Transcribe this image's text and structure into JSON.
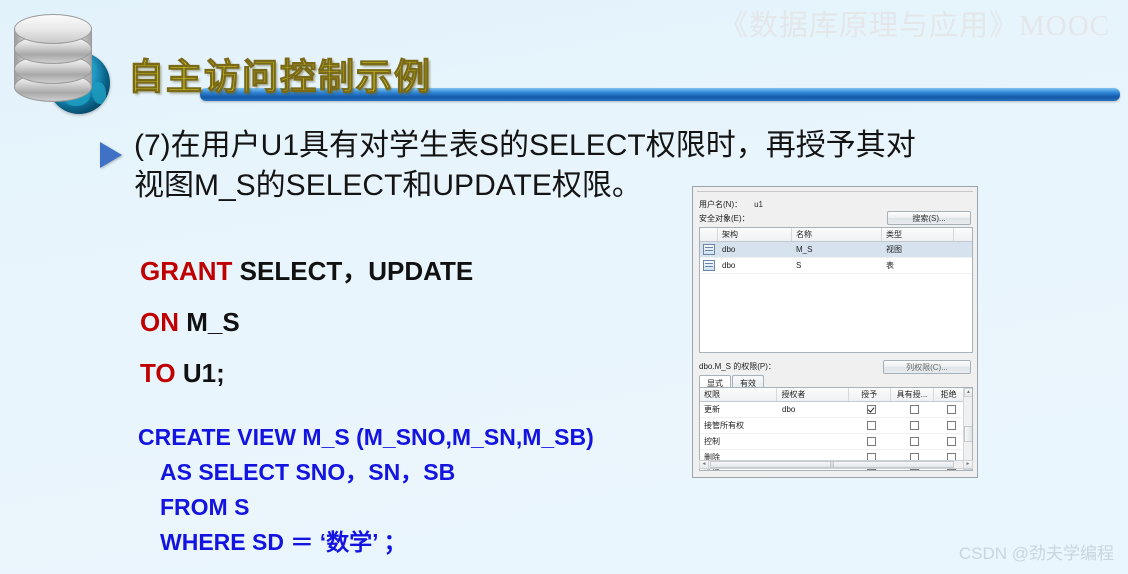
{
  "watermarks": {
    "top_right_cn": "《数据库原理与应用》",
    "top_right_en": "MOOC",
    "bottom_right": "CSDN @劲夫学编程"
  },
  "slide": {
    "title": "自主访问控制示例",
    "body_lines": [
      "(7)在用户U1具有对学生表S的SELECT权限时，再授予其对",
      "视图M_S的SELECT和UPDATE权限。"
    ]
  },
  "sql_grant": {
    "line1_kw": "GRANT",
    "line1_rest": " SELECT，UPDATE",
    "line2_kw": "ON",
    "line2_rest": " M_S",
    "line3_kw": "TO",
    "line3_rest": " U1;"
  },
  "sql_view": {
    "lines": [
      "CREATE VIEW M_S  (M_SNO,M_SN,M_SB)",
      "AS SELECT SNO，SN，SB",
      "FROM S",
      "WHERE SD ＝ ‘数学’ ；"
    ]
  },
  "dialog": {
    "user_label": "用户名(N)：",
    "user_value": "u1",
    "securable_label": "安全对象(E)：",
    "search_button": "搜索(S)...",
    "objects_headers": [
      "架构",
      "名称",
      "类型"
    ],
    "objects_rows": [
      {
        "schema": "dbo",
        "name": "M_S",
        "type": "视图",
        "selected": true
      },
      {
        "schema": "dbo",
        "name": "S",
        "type": "表",
        "selected": false
      }
    ],
    "perm_label": "dbo.M_S 的权限(P)：",
    "col_perm_button": "列权限(C)...",
    "tabs": [
      "显式",
      "有效"
    ],
    "active_tab": "显式",
    "perm_headers": [
      "权限",
      "授权者",
      "授予",
      "具有授...",
      "拒绝"
    ],
    "perm_rows": [
      {
        "perm": "更新",
        "grantor": "dbo",
        "grant": true,
        "withgrant": false,
        "deny": false
      },
      {
        "perm": "接管所有权",
        "grantor": "",
        "grant": false,
        "withgrant": false,
        "deny": false
      },
      {
        "perm": "控制",
        "grantor": "",
        "grant": false,
        "withgrant": false,
        "deny": false
      },
      {
        "perm": "删除",
        "grantor": "",
        "grant": false,
        "withgrant": false,
        "deny": false
      },
      {
        "perm": "选择",
        "grantor": "dbo",
        "grant": true,
        "withgrant": false,
        "deny": false
      }
    ]
  },
  "colors": {
    "title_yellow": "#ffff33",
    "bar_blue": "#1458a8",
    "keyword_red": "#c00000",
    "view_blue": "#1414e0"
  }
}
